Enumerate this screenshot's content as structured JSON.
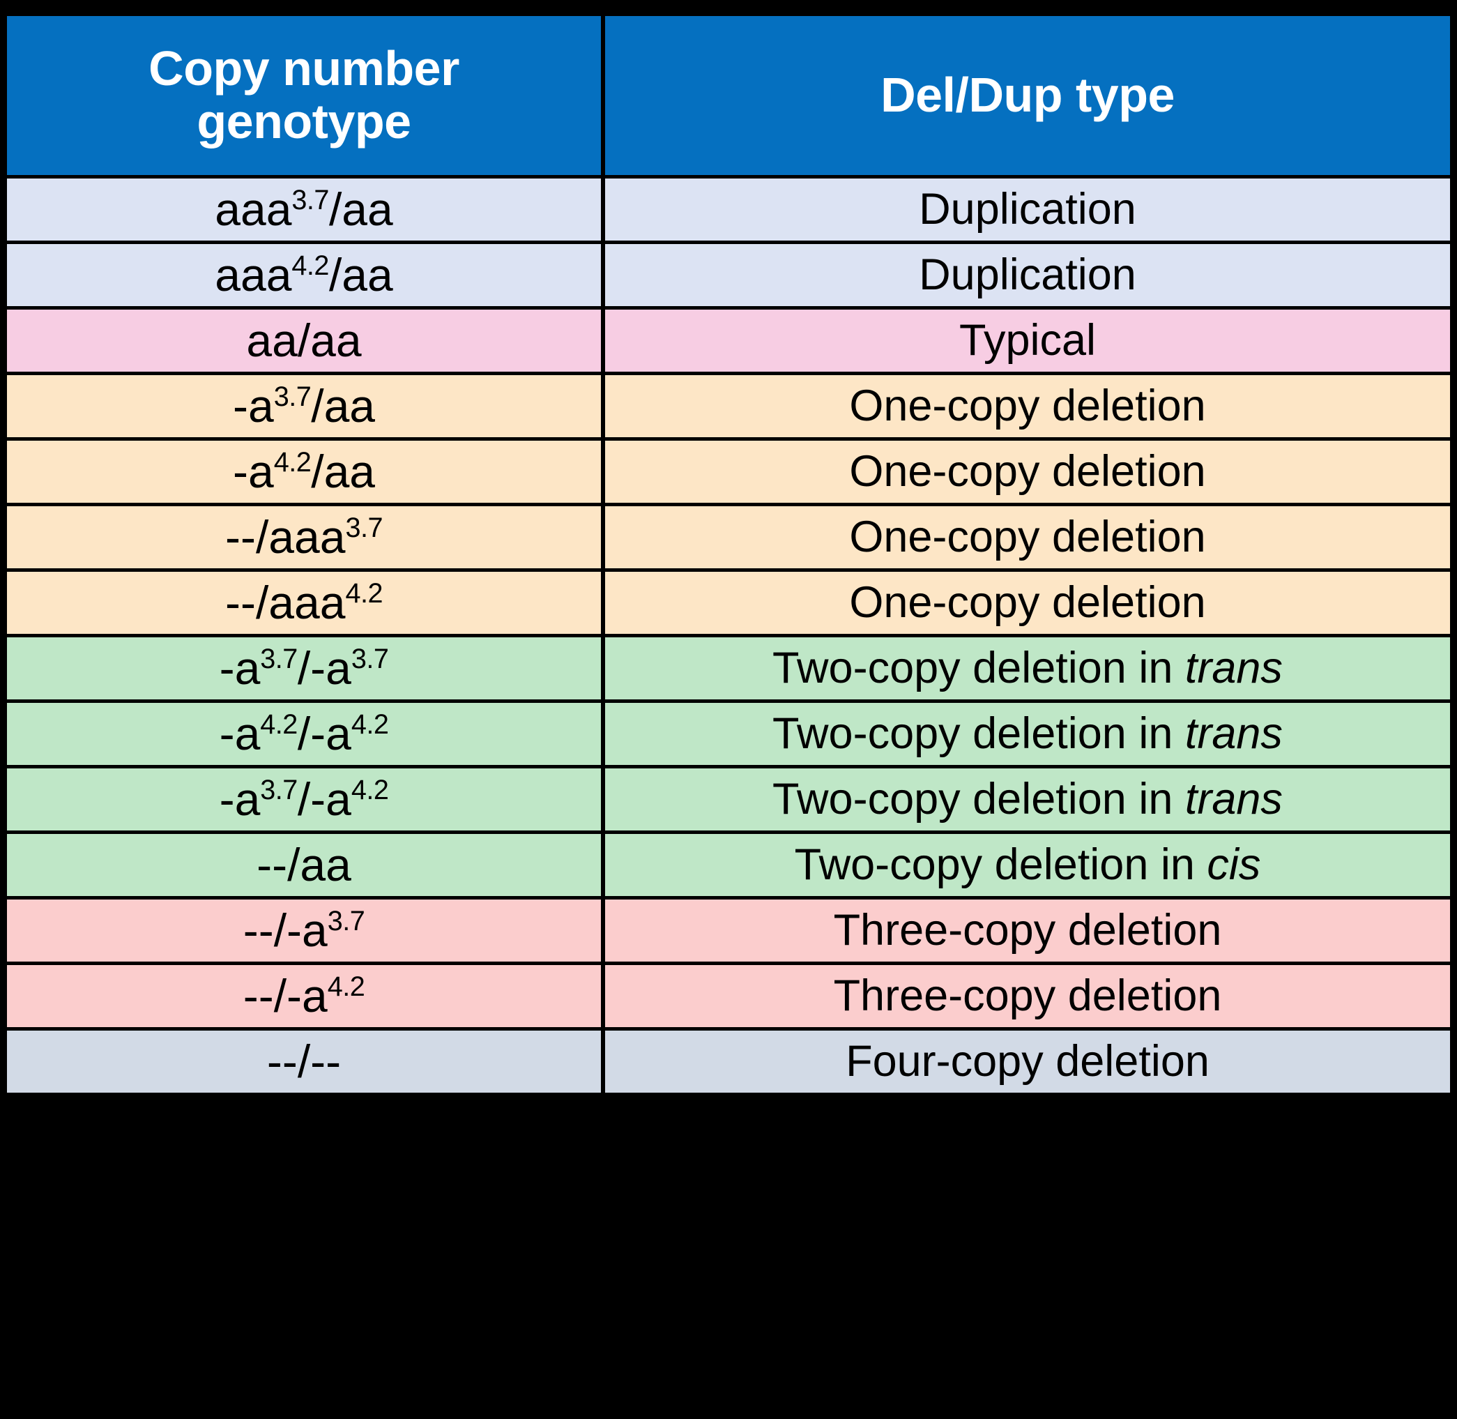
{
  "table": {
    "headers": {
      "genotype": "Copy number genotype",
      "genotype_line1": "Copy number",
      "genotype_line2": "genotype",
      "type": "Del/Dup type"
    },
    "header_bg": "#0570C0",
    "header_text_color": "#FFFFFF",
    "border_color": "#000000",
    "rows": [
      {
        "genotype": "aaa3.7/aa",
        "genotype_base": "aaa",
        "genotype_sup": "3.7",
        "genotype_tail": "/aa",
        "type": "Duplication",
        "type_plain": "Duplication",
        "type_italic": "",
        "bg": "#DCE3F3",
        "color_class": "c-dup"
      },
      {
        "genotype": "aaa4.2/aa",
        "genotype_base": "aaa",
        "genotype_sup": "4.2",
        "genotype_tail": "/aa",
        "type": "Duplication",
        "type_plain": "Duplication",
        "type_italic": "",
        "bg": "#DCE3F3",
        "color_class": "c-dup"
      },
      {
        "genotype": "aa/aa",
        "genotype_base": "aa/aa",
        "genotype_sup": "",
        "genotype_tail": "",
        "type": "Typical",
        "type_plain": "Typical",
        "type_italic": "",
        "bg": "#F7CDE3",
        "color_class": "c-typ"
      },
      {
        "genotype": "-a3.7/aa",
        "genotype_base": "-a",
        "genotype_sup": "3.7",
        "genotype_tail": "/aa",
        "type": "One-copy deletion",
        "type_plain": "One-copy deletion",
        "type_italic": "",
        "bg": "#FDE6C6",
        "color_class": "c-one"
      },
      {
        "genotype": "-a4.2/aa",
        "genotype_base": "-a",
        "genotype_sup": "4.2",
        "genotype_tail": "/aa",
        "type": "One-copy deletion",
        "type_plain": "One-copy deletion",
        "type_italic": "",
        "bg": "#FDE6C6",
        "color_class": "c-one"
      },
      {
        "genotype": "--/aaa3.7",
        "genotype_base": "--/aaa",
        "genotype_sup": "3.7",
        "genotype_tail": "",
        "type": "One-copy deletion",
        "type_plain": "One-copy deletion",
        "type_italic": "",
        "bg": "#FDE6C6",
        "color_class": "c-one"
      },
      {
        "genotype": "--/aaa4.2",
        "genotype_base": "--/aaa",
        "genotype_sup": "4.2",
        "genotype_tail": "",
        "type": "One-copy deletion",
        "type_plain": "One-copy deletion",
        "type_italic": "",
        "bg": "#FDE6C6",
        "color_class": "c-one"
      },
      {
        "genotype": "-a3.7/-a3.7",
        "genotype_base": "-a",
        "genotype_sup": "3.7",
        "genotype_tail": "/-a",
        "genotype_sup2": "3.7",
        "type": "Two-copy deletion in trans",
        "type_plain": "Two-copy deletion in ",
        "type_italic": "trans",
        "bg": "#BFE7C7",
        "color_class": "c-two"
      },
      {
        "genotype": "-a4.2/-a4.2",
        "genotype_base": "-a",
        "genotype_sup": "4.2",
        "genotype_tail": "/-a",
        "genotype_sup2": "4.2",
        "type": "Two-copy deletion in trans",
        "type_plain": "Two-copy deletion in ",
        "type_italic": "trans",
        "bg": "#BFE7C7",
        "color_class": "c-two"
      },
      {
        "genotype": "-a3.7/-a4.2",
        "genotype_base": "-a",
        "genotype_sup": "3.7",
        "genotype_tail": "/-a",
        "genotype_sup2": "4.2",
        "type": "Two-copy deletion in trans",
        "type_plain": "Two-copy deletion in ",
        "type_italic": "trans",
        "bg": "#BFE7C7",
        "color_class": "c-two"
      },
      {
        "genotype": "--/aa",
        "genotype_base": "--/aa",
        "genotype_sup": "",
        "genotype_tail": "",
        "type": "Two-copy deletion in cis",
        "type_plain": "Two-copy deletion in ",
        "type_italic": "cis",
        "bg": "#BFE7C7",
        "color_class": "c-two"
      },
      {
        "genotype": "--/-a3.7",
        "genotype_base": "--/-a",
        "genotype_sup": "3.7",
        "genotype_tail": "",
        "type": "Three-copy deletion",
        "type_plain": "Three-copy deletion",
        "type_italic": "",
        "bg": "#FBCDCD",
        "color_class": "c-three"
      },
      {
        "genotype": "--/-a4.2",
        "genotype_base": "--/-a",
        "genotype_sup": "4.2",
        "genotype_tail": "",
        "type": "Three-copy deletion",
        "type_plain": "Three-copy deletion",
        "type_italic": "",
        "bg": "#FBCDCD",
        "color_class": "c-three"
      },
      {
        "genotype": "--/--",
        "genotype_base": "--/--",
        "genotype_sup": "",
        "genotype_tail": "",
        "type": "Four-copy deletion",
        "type_plain": "Four-copy deletion",
        "type_italic": "",
        "bg": "#D2DAE6",
        "color_class": "c-four"
      }
    ]
  }
}
